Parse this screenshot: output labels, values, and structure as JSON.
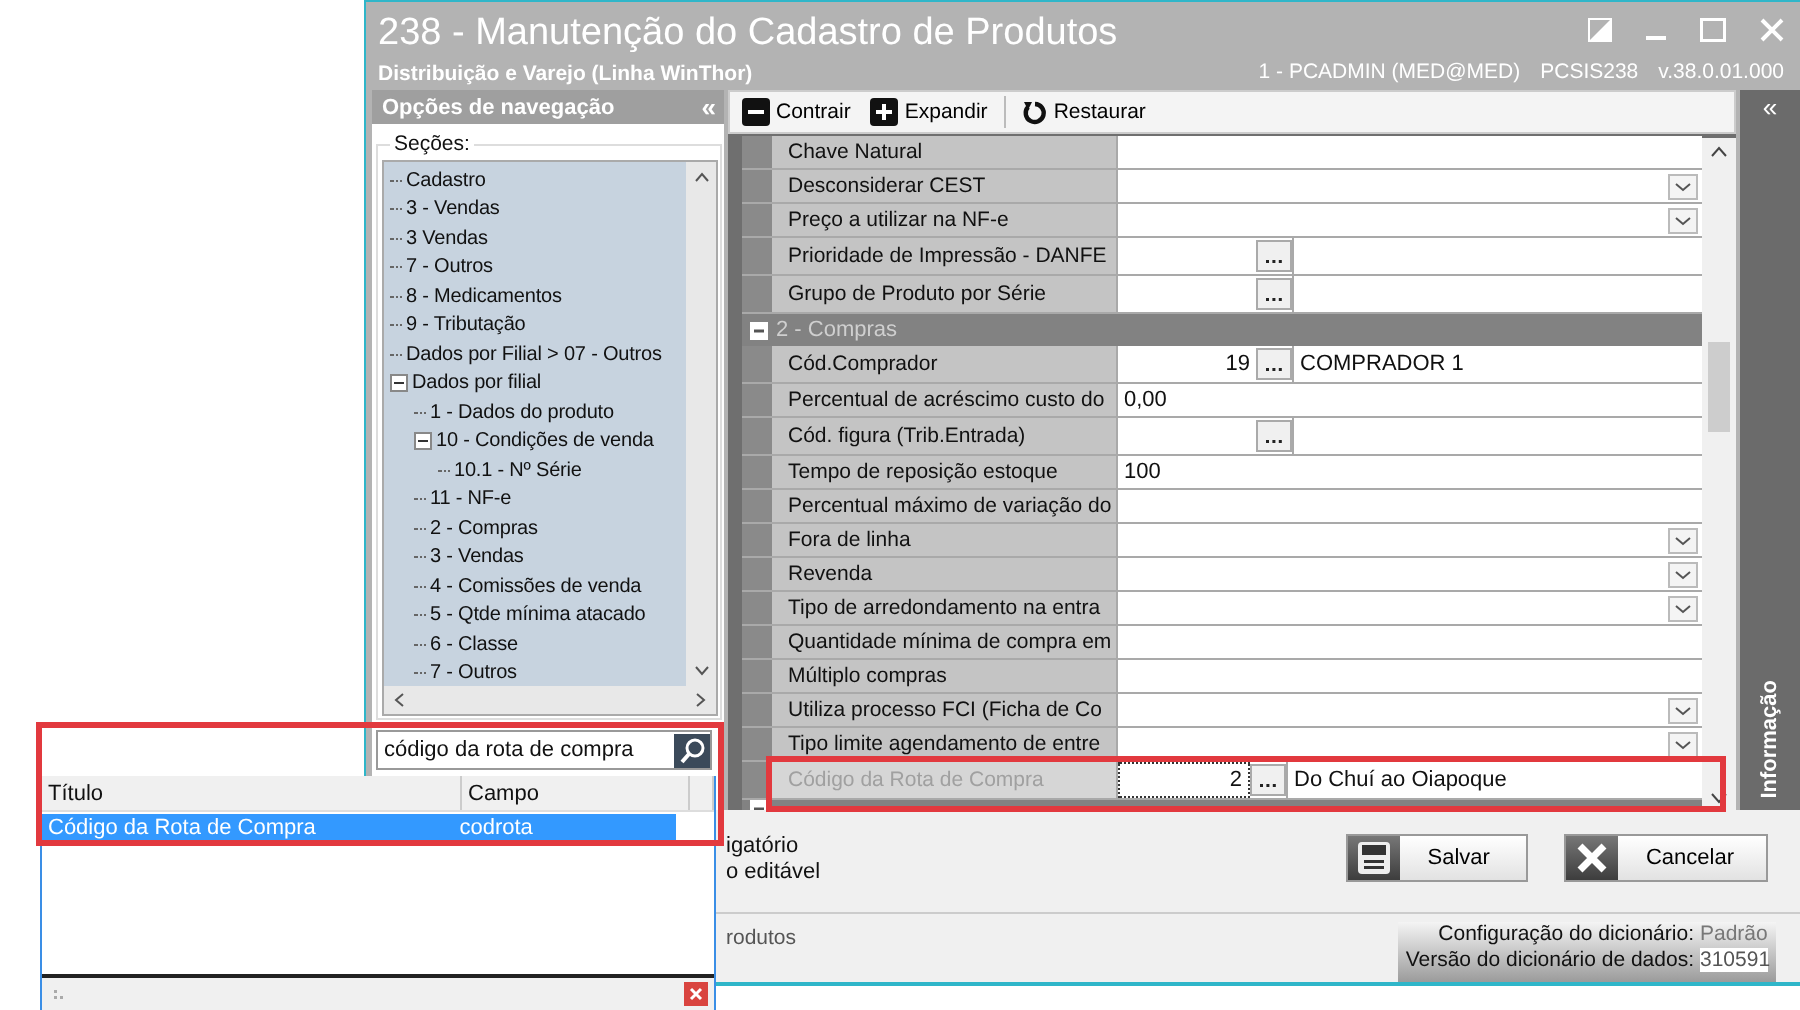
{
  "window": {
    "title": "238 - Manutenção do Cadastro de Produtos",
    "subtitle": "Distribuição e Varejo (Linha WinThor)",
    "user": "1 - PCADMIN (MED@MED)",
    "routine": "PCSIS238",
    "version": "v.38.0.01.000"
  },
  "navigation": {
    "header": "Opções de navegação",
    "collapse": "«",
    "sections_label": "Seções:",
    "tree": [
      {
        "label": "Cadastro"
      },
      {
        "label": "3 - Vendas"
      },
      {
        "label": "3 Vendas"
      },
      {
        "label": "7 - Outros"
      },
      {
        "label": "8 - Medicamentos"
      },
      {
        "label": "9 - Tributação"
      },
      {
        "label": "Dados por Filial > 07 - Outros"
      },
      {
        "label": "Dados por filial",
        "expanded": true,
        "children": [
          {
            "label": "1 - Dados do produto"
          },
          {
            "label": "10 - Condições de venda",
            "expanded": true,
            "children": [
              {
                "label": "10.1 - Nº Série"
              }
            ]
          },
          {
            "label": "11 - NF-e"
          },
          {
            "label": "2 - Compras"
          },
          {
            "label": "3 - Vendas"
          },
          {
            "label": "4 - Comissões de venda"
          },
          {
            "label": "5 - Qtde mínima atacado"
          },
          {
            "label": "6 - Classe"
          },
          {
            "label": "7 - Outros"
          }
        ]
      }
    ],
    "search": {
      "value": "código da rota de compra"
    }
  },
  "toolbar": [
    {
      "label": "Contrair",
      "kind": "collapse"
    },
    {
      "label": "Expandir",
      "kind": "expand"
    },
    {
      "label": "Restaurar",
      "kind": "restore"
    }
  ],
  "properties": [
    {
      "kind": "text",
      "label": "Chave Natural",
      "disabled": false
    },
    {
      "kind": "dropdown",
      "label": "Desconsiderar CEST",
      "disabled": false
    },
    {
      "kind": "dropdown",
      "label": "Preço a utilizar na NF-e",
      "disabled": false
    },
    {
      "kind": "lookup",
      "label": "Prioridade de Impressão - DANFE",
      "disabled": false
    },
    {
      "kind": "lookup",
      "label": "Grupo de Produto por Série",
      "disabled": false
    },
    {
      "kind": "group",
      "label": "2 - Compras",
      "expanded": true
    },
    {
      "kind": "lookup",
      "label": "Cód.Comprador",
      "code": "19",
      "description": "COMPRADOR 1",
      "disabled": false
    },
    {
      "kind": "text",
      "label": "Percentual de acréscimo custo do",
      "value": "0,00",
      "disabled": false
    },
    {
      "kind": "lookup",
      "label": "Cód. figura (Trib.Entrada)",
      "disabled": false
    },
    {
      "kind": "text",
      "label": "Tempo de reposição estoque",
      "value": "100",
      "disabled": false
    },
    {
      "kind": "text",
      "label": "Percentual máximo de variação do",
      "disabled": false
    },
    {
      "kind": "dropdown",
      "label": "Fora de linha",
      "disabled": false
    },
    {
      "kind": "dropdown",
      "label": "Revenda",
      "disabled": false
    },
    {
      "kind": "dropdown",
      "label": "Tipo de arredondamento na entra",
      "disabled": false
    },
    {
      "kind": "text",
      "label": "Quantidade mínima de compra em",
      "disabled": false
    },
    {
      "kind": "text",
      "label": "Múltiplo compras",
      "disabled": false
    },
    {
      "kind": "dropdown",
      "label": "Utiliza processo FCI (Ficha de Co",
      "disabled": false
    },
    {
      "kind": "dropdown",
      "label": "Tipo limite agendamento de entre",
      "disabled": false
    },
    {
      "kind": "lookup",
      "label": "Código da Rota de Compra",
      "code": "2",
      "description": "Do Chuí ao Oiapoque",
      "disabled": true
    }
  ],
  "info_panel": {
    "collapse": "«",
    "label": "Informação"
  },
  "legend": [
    "igatório",
    "o editável"
  ],
  "buttons": [
    {
      "label": "Salvar",
      "kind": "save"
    },
    {
      "label": "Cancelar",
      "kind": "cancel"
    }
  ],
  "status_bar": {
    "left": "rodutos",
    "config_label": "Configuração do dicionário:",
    "config_value": "Padrão",
    "version_label": "Versão do dicionário de dados:",
    "version_value": "310591"
  },
  "search_results": {
    "columns": [
      "Título",
      "Campo"
    ],
    "rows": [
      {
        "title": "Código da Rota de Compra",
        "field": "codrota",
        "selected": true
      }
    ]
  }
}
